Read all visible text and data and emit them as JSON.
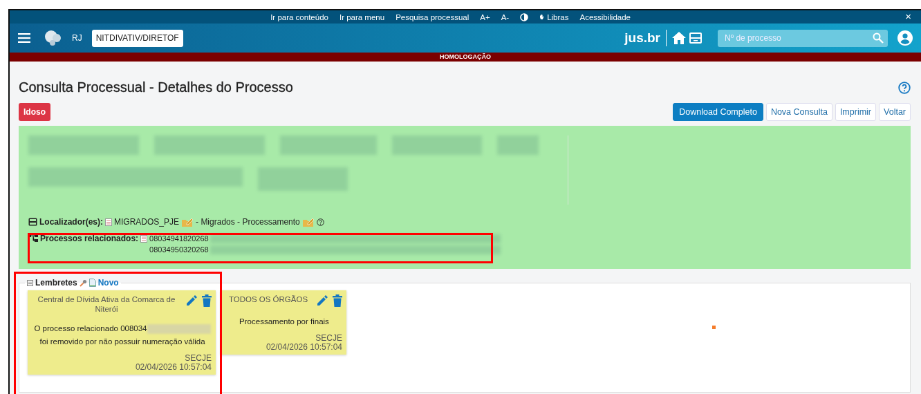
{
  "accessibility_bar": {
    "links": [
      "Ir para conteúdo",
      "Ir para menu",
      "Pesquisa processual",
      "A+",
      "A-"
    ],
    "libras": "Libras",
    "accessibility": "Acessibilidade",
    "close": "×"
  },
  "header": {
    "state": "RJ",
    "unit_select": "NITDIVATIV/DIRETOF",
    "brand": "jus.br",
    "search": {
      "placeholder": "Nº de processo"
    }
  },
  "environment_banner": "HOMOLOGAÇÃO",
  "page": {
    "title": "Consulta Processual - Detalhes do Processo",
    "tags": [
      "Idoso"
    ],
    "buttons": [
      {
        "label": "Download Completo",
        "primary": true
      },
      {
        "label": "Nova Consulta",
        "primary": false
      },
      {
        "label": "Imprimir",
        "primary": false
      },
      {
        "label": "Voltar",
        "primary": false
      }
    ]
  },
  "details": {
    "locators": {
      "label": "Localizador(es):",
      "code": "MIGRADOS_PJE",
      "description": "- Migrados - Processamento"
    },
    "related": {
      "label": "Processos relacionados:",
      "numbers": [
        "08034941820268",
        "08034950320268"
      ]
    }
  },
  "reminders": {
    "legend": "Lembretes",
    "new_link": "Novo",
    "cards": [
      {
        "origin": "Central de Dívida Ativa da Comarca de Niterói",
        "text_parts": [
          "O processo relacionado 008034",
          "foi removido por não possuir numeração válida"
        ],
        "author": "SECJE",
        "timestamp": "02/04/2026 10:57:04"
      },
      {
        "origin": "TODOS OS ÓRGÃOS",
        "text_parts": [
          "Processamento por finais"
        ],
        "author": "SECJE",
        "timestamp": "02/04/2026 10:57:04"
      }
    ]
  }
}
